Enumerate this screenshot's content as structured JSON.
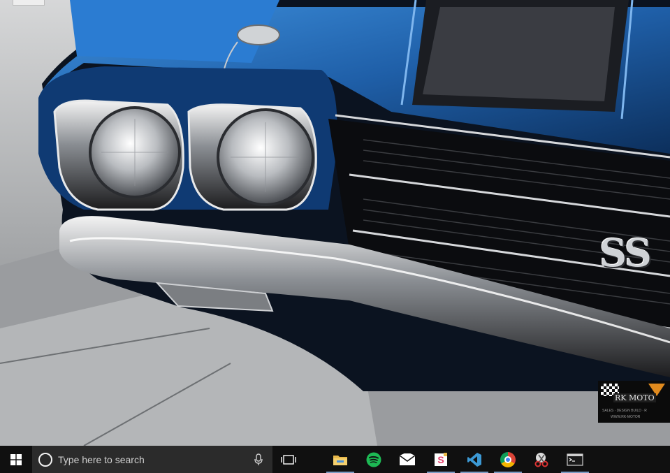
{
  "desktop": {
    "wallpaper_badge": {
      "line1": "RK MOTO",
      "line2": "SALES · DESIGN BUILD · R",
      "line3": "WWW.RK-MOTOR"
    },
    "emblem": "SS"
  },
  "taskbar": {
    "start_icon": "windows-logo-icon",
    "search": {
      "placeholder": "Type here to search",
      "icon": "cortana-circle-icon",
      "mic_icon": "microphone-icon"
    },
    "task_view_icon": "task-view-icon",
    "pinned_apps": [
      {
        "name": "File Explorer",
        "icon": "folder-icon",
        "running": true
      },
      {
        "name": "Spotify",
        "icon": "spotify-icon",
        "running": false,
        "color": "#1db954"
      },
      {
        "name": "Mail",
        "icon": "mail-icon",
        "running": false
      },
      {
        "name": "Sublime / S app",
        "icon": "s-app-icon",
        "running": true
      },
      {
        "name": "Visual Studio Code",
        "icon": "vscode-icon",
        "running": true,
        "color": "#3c99d4"
      },
      {
        "name": "Google Chrome",
        "icon": "chrome-icon",
        "running": true
      },
      {
        "name": "Snipping Tool",
        "icon": "snipping-tool-icon",
        "running": false
      },
      {
        "name": "Command Prompt",
        "icon": "terminal-icon",
        "running": true
      }
    ]
  },
  "colors": {
    "taskbar_bg": "#101010",
    "search_bg": "#2b2b2b",
    "running_indicator": "#7a9cc4",
    "car_blue": "#1f5fa8"
  }
}
